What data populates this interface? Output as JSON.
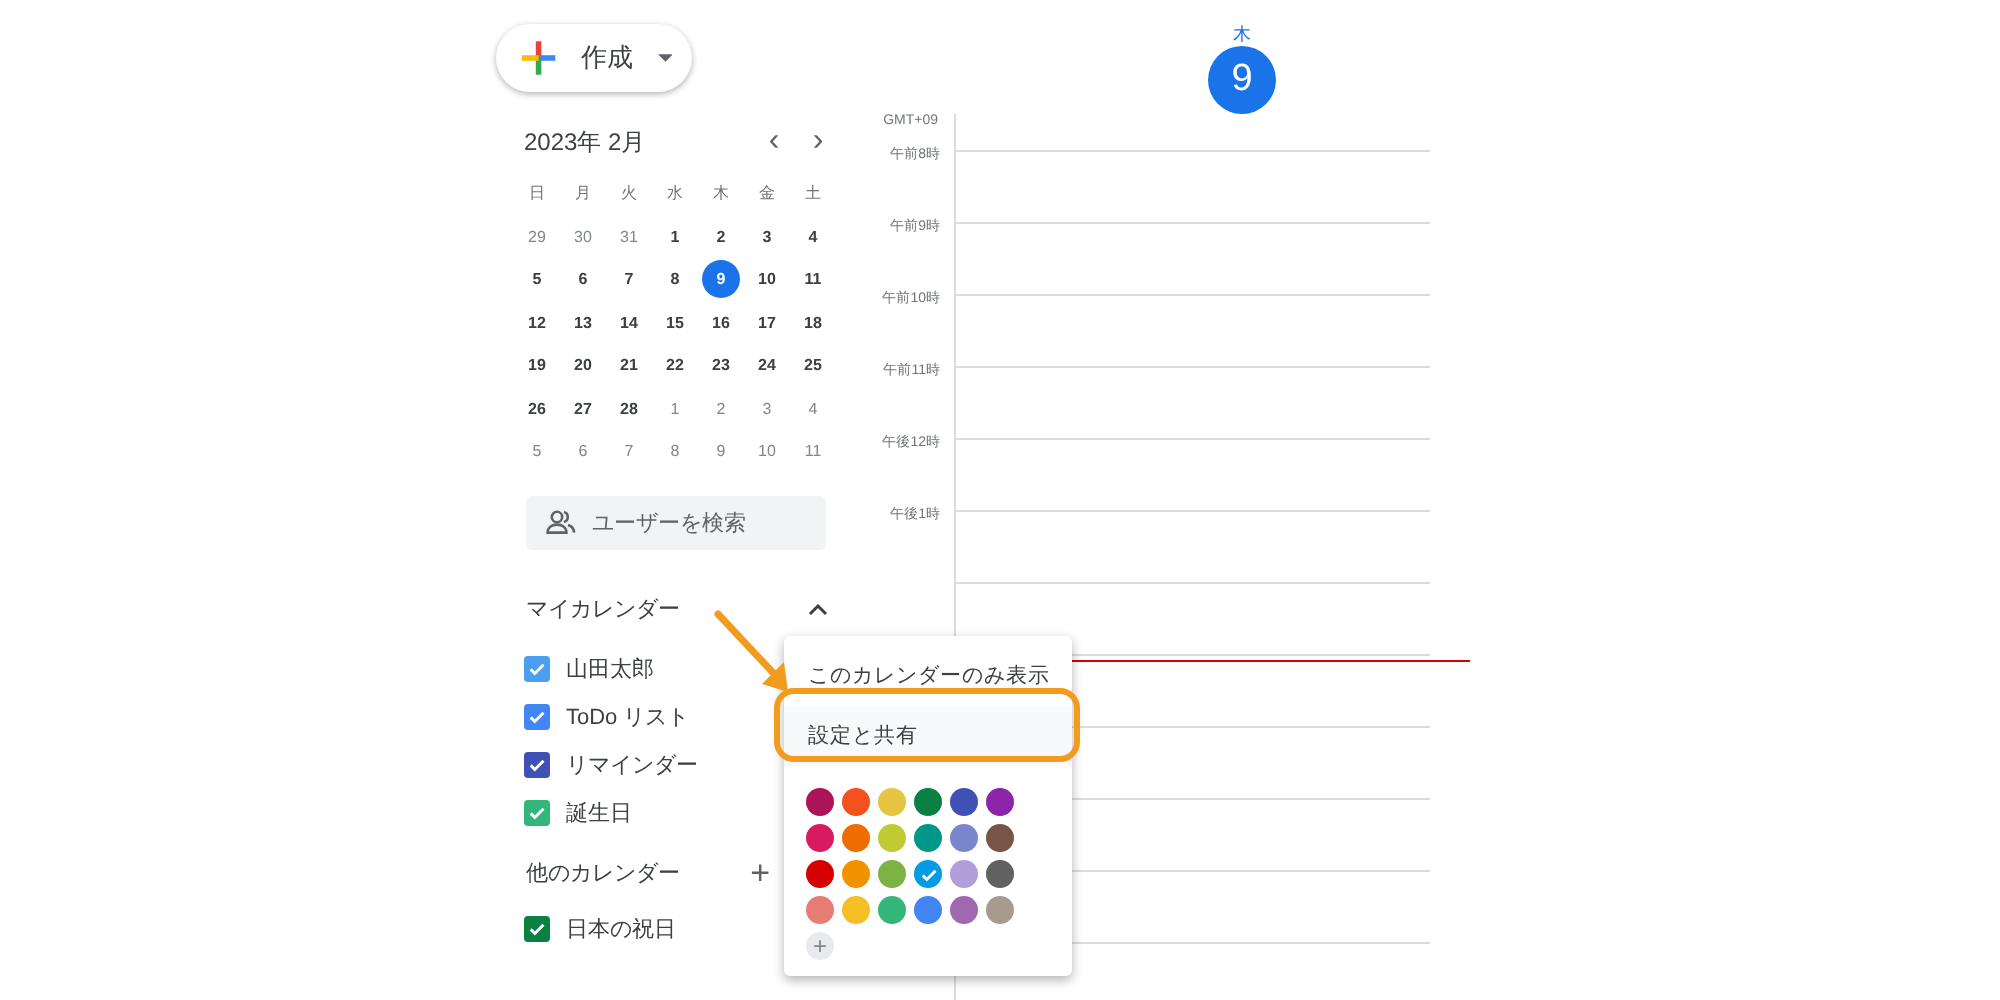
{
  "create_button": {
    "label": "作成"
  },
  "mini_calendar": {
    "title": "2023年 2月",
    "prev": "‹",
    "next": "›",
    "weekdays": [
      "日",
      "月",
      "火",
      "水",
      "木",
      "金",
      "土"
    ],
    "weeks": [
      [
        {
          "day": "29",
          "current_month": false,
          "selected": false
        },
        {
          "day": "30",
          "current_month": false,
          "selected": false
        },
        {
          "day": "31",
          "current_month": false,
          "selected": false
        },
        {
          "day": "1",
          "current_month": true,
          "selected": false
        },
        {
          "day": "2",
          "current_month": true,
          "selected": false
        },
        {
          "day": "3",
          "current_month": true,
          "selected": false
        },
        {
          "day": "4",
          "current_month": true,
          "selected": false
        }
      ],
      [
        {
          "day": "5",
          "current_month": true,
          "selected": false
        },
        {
          "day": "6",
          "current_month": true,
          "selected": false
        },
        {
          "day": "7",
          "current_month": true,
          "selected": false
        },
        {
          "day": "8",
          "current_month": true,
          "selected": false
        },
        {
          "day": "9",
          "current_month": true,
          "selected": true
        },
        {
          "day": "10",
          "current_month": true,
          "selected": false
        },
        {
          "day": "11",
          "current_month": true,
          "selected": false
        }
      ],
      [
        {
          "day": "12",
          "current_month": true,
          "selected": false
        },
        {
          "day": "13",
          "current_month": true,
          "selected": false
        },
        {
          "day": "14",
          "current_month": true,
          "selected": false
        },
        {
          "day": "15",
          "current_month": true,
          "selected": false
        },
        {
          "day": "16",
          "current_month": true,
          "selected": false
        },
        {
          "day": "17",
          "current_month": true,
          "selected": false
        },
        {
          "day": "18",
          "current_month": true,
          "selected": false
        }
      ],
      [
        {
          "day": "19",
          "current_month": true,
          "selected": false
        },
        {
          "day": "20",
          "current_month": true,
          "selected": false
        },
        {
          "day": "21",
          "current_month": true,
          "selected": false
        },
        {
          "day": "22",
          "current_month": true,
          "selected": false
        },
        {
          "day": "23",
          "current_month": true,
          "selected": false
        },
        {
          "day": "24",
          "current_month": true,
          "selected": false
        },
        {
          "day": "25",
          "current_month": true,
          "selected": false
        }
      ],
      [
        {
          "day": "26",
          "current_month": true,
          "selected": false
        },
        {
          "day": "27",
          "current_month": true,
          "selected": false
        },
        {
          "day": "28",
          "current_month": true,
          "selected": false
        },
        {
          "day": "1",
          "current_month": false,
          "selected": false
        },
        {
          "day": "2",
          "current_month": false,
          "selected": false
        },
        {
          "day": "3",
          "current_month": false,
          "selected": false
        },
        {
          "day": "4",
          "current_month": false,
          "selected": false
        }
      ],
      [
        {
          "day": "5",
          "current_month": false,
          "selected": false
        },
        {
          "day": "6",
          "current_month": false,
          "selected": false
        },
        {
          "day": "7",
          "current_month": false,
          "selected": false
        },
        {
          "day": "8",
          "current_month": false,
          "selected": false
        },
        {
          "day": "9",
          "current_month": false,
          "selected": false
        },
        {
          "day": "10",
          "current_month": false,
          "selected": false
        },
        {
          "day": "11",
          "current_month": false,
          "selected": false
        }
      ]
    ]
  },
  "search": {
    "placeholder": "ユーザーを検索"
  },
  "my_calendars": {
    "title": "マイカレンダー",
    "expanded": true,
    "items": [
      {
        "label": "山田太郎",
        "checked": true,
        "color": "#4a9ff0"
      },
      {
        "label": "ToDo リスト",
        "checked": true,
        "color": "#4285f4"
      },
      {
        "label": "リマインダー",
        "checked": true,
        "color": "#3f51b5"
      },
      {
        "label": "誕生日",
        "checked": true,
        "color": "#33b679"
      }
    ]
  },
  "other_calendars": {
    "title": "他のカレンダー",
    "add": "+",
    "items": [
      {
        "label": "日本の祝日",
        "checked": true,
        "color": "#0b8043"
      }
    ]
  },
  "day_header": {
    "weekday": "木",
    "day": "9"
  },
  "time_grid": {
    "timezone": "GMT+09",
    "hours": [
      {
        "label": "午前8時"
      },
      {
        "label": "午前9時"
      },
      {
        "label": "午前10時"
      },
      {
        "label": "午前11時"
      },
      {
        "label": "午後12時"
      },
      {
        "label": "午後1時"
      }
    ]
  },
  "context_menu": {
    "items": [
      {
        "label": "このカレンダーのみ表示",
        "highlighted": false
      },
      {
        "label": "設定と共有",
        "highlighted": true
      }
    ],
    "colors": [
      {
        "color": "#ad1457",
        "selected": false
      },
      {
        "color": "#f4511e",
        "selected": false
      },
      {
        "color": "#e4c441",
        "selected": false
      },
      {
        "color": "#0b8043",
        "selected": false
      },
      {
        "color": "#3f51b5",
        "selected": false
      },
      {
        "color": "#8e24aa",
        "selected": false
      },
      {
        "color": "#d81b60",
        "selected": false
      },
      {
        "color": "#ef6c00",
        "selected": false
      },
      {
        "color": "#c0ca33",
        "selected": false
      },
      {
        "color": "#009688",
        "selected": false
      },
      {
        "color": "#7986cb",
        "selected": false
      },
      {
        "color": "#795548",
        "selected": false
      },
      {
        "color": "#d50000",
        "selected": false
      },
      {
        "color": "#f09300",
        "selected": false
      },
      {
        "color": "#7cb342",
        "selected": false
      },
      {
        "color": "#039be5",
        "selected": true
      },
      {
        "color": "#b39ddb",
        "selected": false
      },
      {
        "color": "#616161",
        "selected": false
      },
      {
        "color": "#e67c73",
        "selected": false
      },
      {
        "color": "#f6bf26",
        "selected": false
      },
      {
        "color": "#33b679",
        "selected": false
      },
      {
        "color": "#4285f4",
        "selected": false
      },
      {
        "color": "#9e69af",
        "selected": false
      },
      {
        "color": "#a79b8e",
        "selected": false
      }
    ],
    "add_color": "+"
  }
}
